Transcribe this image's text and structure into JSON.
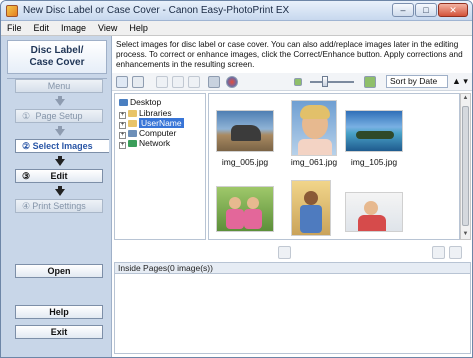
{
  "window": {
    "title": "New Disc Label or Case Cover - Canon Easy-PhotoPrint EX",
    "controls": {
      "minimize": "–",
      "maximize": "□",
      "close": "✕"
    }
  },
  "menubar": {
    "items": [
      "File",
      "Edit",
      "Image",
      "View",
      "Help"
    ]
  },
  "nav": {
    "header_line1": "Disc Label/",
    "header_line2": "Case Cover",
    "menu": "Menu",
    "steps": [
      {
        "num": "①",
        "label": "Page Setup"
      },
      {
        "num": "②",
        "label": "Select Images"
      },
      {
        "num": "③",
        "label": "Edit"
      },
      {
        "num": "④",
        "label": "Print Settings"
      }
    ],
    "open": "Open",
    "help": "Help",
    "exit": "Exit"
  },
  "instructions": "Select images for disc label or case cover. You can also add/replace images later in the editing process. To correct or enhance images, click the Correct/Enhance button. Apply corrections and enhancements in the resulting screen.",
  "toolbar": {
    "sort_label": "Sort by Date",
    "sort_arrow": "▲ ▾"
  },
  "folders": [
    {
      "label": "Desktop",
      "level": 0,
      "expander": ""
    },
    {
      "label": "Libraries",
      "level": 1,
      "expander": "+"
    },
    {
      "label": "UserName",
      "level": 1,
      "expander": "+",
      "selected": true
    },
    {
      "label": "Computer",
      "level": 1,
      "expander": "+"
    },
    {
      "label": "Network",
      "level": 1,
      "expander": "+"
    }
  ],
  "thumbnails": [
    {
      "filename": "img_005.jpg"
    },
    {
      "filename": "img_061.jpg"
    },
    {
      "filename": "img_105.jpg"
    },
    {
      "filename": ""
    },
    {
      "filename": ""
    },
    {
      "filename": ""
    }
  ],
  "inside_pages": {
    "label": "Inside Pages(0 image(s))"
  },
  "colors": {
    "accent": "#2a56a6",
    "selection": "#3875d7",
    "nav_bg": "#c8d6e8"
  }
}
